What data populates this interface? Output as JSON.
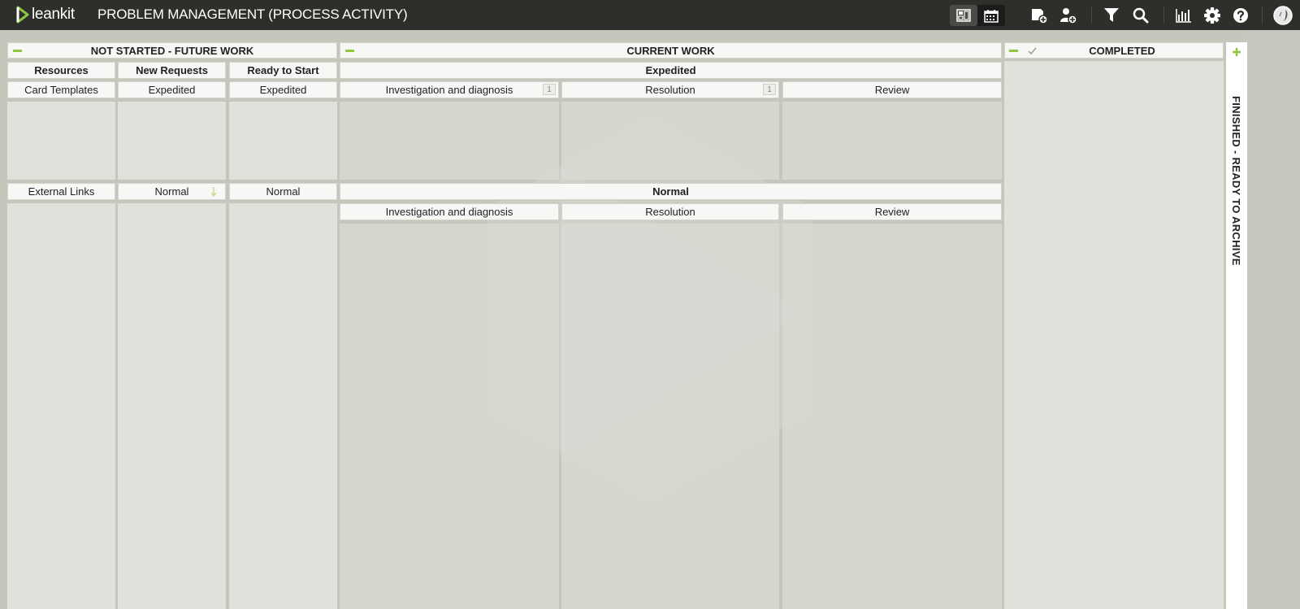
{
  "app": {
    "logo_text": "leankit",
    "board_title": "PROBLEM MANAGEMENT (PROCESS ACTIVITY)"
  },
  "toolbar": {
    "icons": [
      "board-view-icon",
      "calendar-view-icon",
      "add-card-icon",
      "add-user-icon",
      "filter-icon",
      "search-icon",
      "analytics-icon",
      "settings-icon",
      "help-icon",
      "avatar"
    ]
  },
  "colors": {
    "accent": "#8dc63f",
    "topbar": "#2e2f2b",
    "board_bg": "#c4c7bc"
  },
  "sections": {
    "not_started": {
      "title": "NOT STARTED - FUTURE WORK",
      "columns": [
        {
          "label": "Resources",
          "sub_top": "Card Templates",
          "sub_bottom": "External Links"
        },
        {
          "label": "New Requests",
          "sub_top": "Expedited",
          "sub_bottom": "Normal"
        },
        {
          "label": "Ready to Start",
          "sub_top": "Expedited",
          "sub_bottom": "Normal"
        }
      ]
    },
    "current": {
      "title": "CURRENT WORK",
      "expedited": {
        "label": "Expedited",
        "columns": [
          {
            "label": "Investigation and diagnosis",
            "wip": "1"
          },
          {
            "label": "Resolution",
            "wip": "1"
          },
          {
            "label": "Review"
          }
        ]
      },
      "normal": {
        "label": "Normal",
        "columns": [
          {
            "label": "Investigation and diagnosis"
          },
          {
            "label": "Resolution"
          },
          {
            "label": "Review"
          }
        ]
      }
    },
    "completed": {
      "title": "COMPLETED"
    },
    "finished": {
      "title": "FINISHED - READY TO ARCHIVE"
    }
  }
}
